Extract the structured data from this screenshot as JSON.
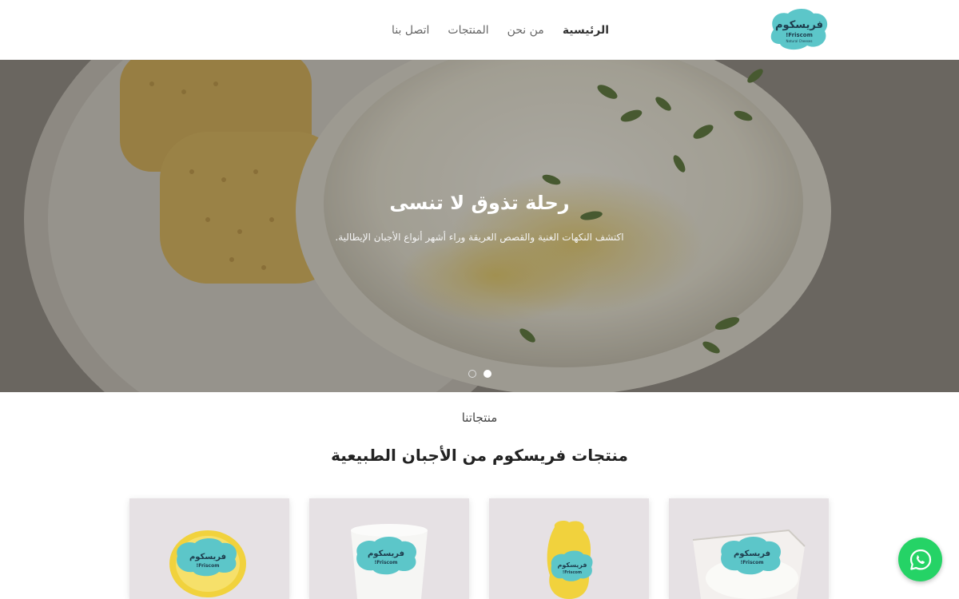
{
  "header": {
    "logo_alt_text": "فريسكوم Friscom!",
    "nav": [
      {
        "label": "الرئيسية",
        "active": true
      },
      {
        "label": "من نحن",
        "active": false
      },
      {
        "label": "المنتجات",
        "active": false
      },
      {
        "label": "اتصل بنا",
        "active": false
      }
    ]
  },
  "hero": {
    "title": "رحلة تذوق لا تنسى",
    "subtitle": "اكتشف النكهات الغنية والقصص العريقة وراء أشهر أنواع الأجبان الإيطالية.",
    "slides_count": 2,
    "active_slide": 2
  },
  "products": {
    "eyebrow": "منتجاتنا",
    "title": "منتجات فريسكوم من الأجبان الطبيعية",
    "items": [
      {
        "icon": "cheese-package-image"
      },
      {
        "icon": "cheese-package-image"
      },
      {
        "icon": "cheese-package-image"
      },
      {
        "icon": "cheese-package-image"
      }
    ]
  },
  "whatsapp": {
    "icon": "whatsapp-icon",
    "color": "#25d366"
  },
  "colors": {
    "brand_teal": "#5cc6c9",
    "accent_yellow": "#f2d24a"
  }
}
